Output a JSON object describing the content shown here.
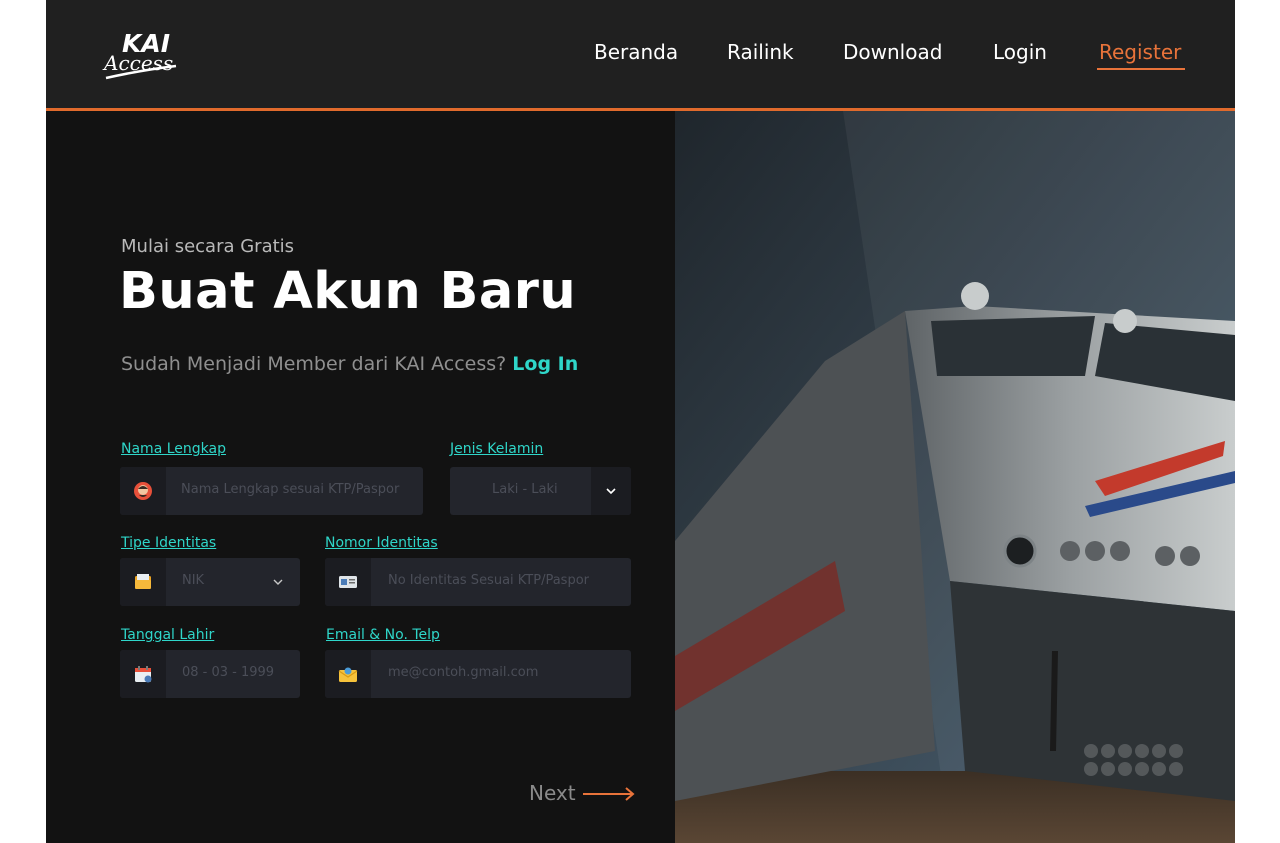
{
  "brand": {
    "logo_top": "KAI",
    "logo_bottom": "Access"
  },
  "nav": {
    "items": [
      {
        "label": "Beranda",
        "active": false
      },
      {
        "label": "Railink",
        "active": false
      },
      {
        "label": "Download",
        "active": false
      },
      {
        "label": "Login",
        "active": false
      },
      {
        "label": "Register",
        "active": true
      }
    ]
  },
  "hero": {
    "eyebrow": "Mulai secara Gratis",
    "title": "Buat Akun Baru",
    "member_text": "Sudah Menjadi Member dari KAI Access?",
    "login_link": "Log In"
  },
  "form": {
    "full_name": {
      "label": "Nama Lengkap",
      "placeholder": "Nama Lengkap sesuai KTP/Paspor",
      "icon": "avatar-icon"
    },
    "gender": {
      "label": "Jenis Kelamin",
      "value": "Laki - Laki",
      "icon": "chevron-down-icon"
    },
    "id_type": {
      "label": "Tipe Identitas",
      "value": "NIK",
      "icon": "folder-icon"
    },
    "id_number": {
      "label": "Nomor Identitas",
      "placeholder": "No Identitas Sesuai KTP/Paspor",
      "icon": "id-card-icon"
    },
    "birth_date": {
      "label": "Tanggal Lahir",
      "value": "08 - 03 - 1999",
      "icon": "calendar-icon"
    },
    "contact": {
      "label": "Email & No. Telp",
      "placeholder": "me@contoh.gmail.com",
      "icon": "envelope-icon"
    }
  },
  "next_label": "Next",
  "colors": {
    "accent": "#e8733a",
    "teal": "#2fd6c9",
    "background": "#121212",
    "header": "#202020"
  }
}
